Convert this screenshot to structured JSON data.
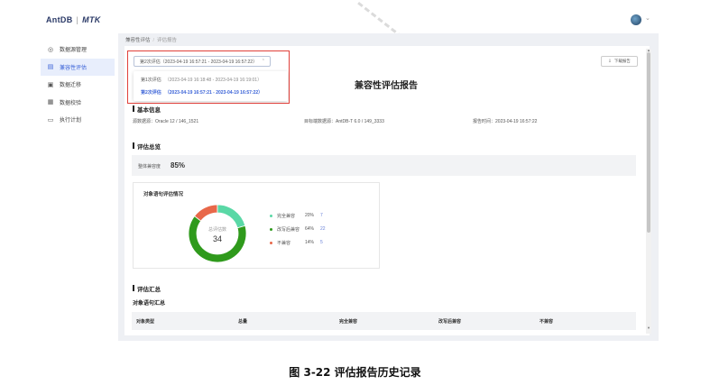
{
  "app": {
    "logo": "AntDB",
    "product": "MTK"
  },
  "sidebar": {
    "items": [
      {
        "label": "数据源管理",
        "icon": "database-icon"
      },
      {
        "label": "兼容性评估",
        "icon": "report-icon"
      },
      {
        "label": "数据迁移",
        "icon": "migrate-icon"
      },
      {
        "label": "数据校验",
        "icon": "check-icon"
      },
      {
        "label": "执行计划",
        "icon": "calendar-icon"
      }
    ],
    "active_index": 1
  },
  "breadcrumb": {
    "parent": "兼容性评估",
    "current": "评估报告"
  },
  "report": {
    "title": "兼容性评估报告",
    "download_label": "下载报告",
    "selector_value": "第2次评估（2023-04-19 16:57:21 - 2023-04-19 16:57:22）",
    "options": [
      {
        "name": "第1次评估",
        "range": "（2023-04-19 16:18:48 - 2023-04-19 16:19:01）",
        "selected": false
      },
      {
        "name": "第2次评估",
        "range": "（2023-04-19 16:57:21 - 2023-04-19 16:57:22）",
        "selected": true
      }
    ]
  },
  "basic_info": {
    "title": "基本信息",
    "source_label": "源数据源：",
    "source_value": "Oracle 12 / 146_1521",
    "target_label": "目标端数据源：",
    "target_value": "AntDB-T 6.0 / 149_3333",
    "time_label": "报告时间：",
    "time_value": "2023-04-19 16:57:22"
  },
  "overview": {
    "title": "评估总览",
    "compat_label": "整体兼容度",
    "compat_value": "85%"
  },
  "object_stats": {
    "title": "对象语句评估情况",
    "center_label": "总评估数",
    "total": "34",
    "legend": [
      {
        "name": "完全兼容",
        "percent": "20%",
        "count": "7",
        "color": "#5ad8a6"
      },
      {
        "name": "改写后兼容",
        "percent": "64%",
        "count": "22",
        "color": "#2f9a1c"
      },
      {
        "name": "不兼容",
        "percent": "14%",
        "count": "5",
        "color": "#e8684a"
      }
    ]
  },
  "chart_data": {
    "type": "pie",
    "categories": [
      "完全兼容",
      "改写后兼容",
      "不兼容"
    ],
    "values": [
      7,
      22,
      5
    ],
    "percents": [
      20,
      64,
      14
    ],
    "total": 34,
    "title": "对象语句评估情况",
    "colors": [
      "#5ad8a6",
      "#2f9a1c",
      "#e8684a"
    ]
  },
  "summary": {
    "title": "评估汇总",
    "subtitle": "对象语句汇总",
    "columns": [
      "对象类型",
      "总量",
      "完全兼容",
      "改写后兼容",
      "不兼容"
    ]
  },
  "caption": "图 3-22  评估报告历史记录"
}
